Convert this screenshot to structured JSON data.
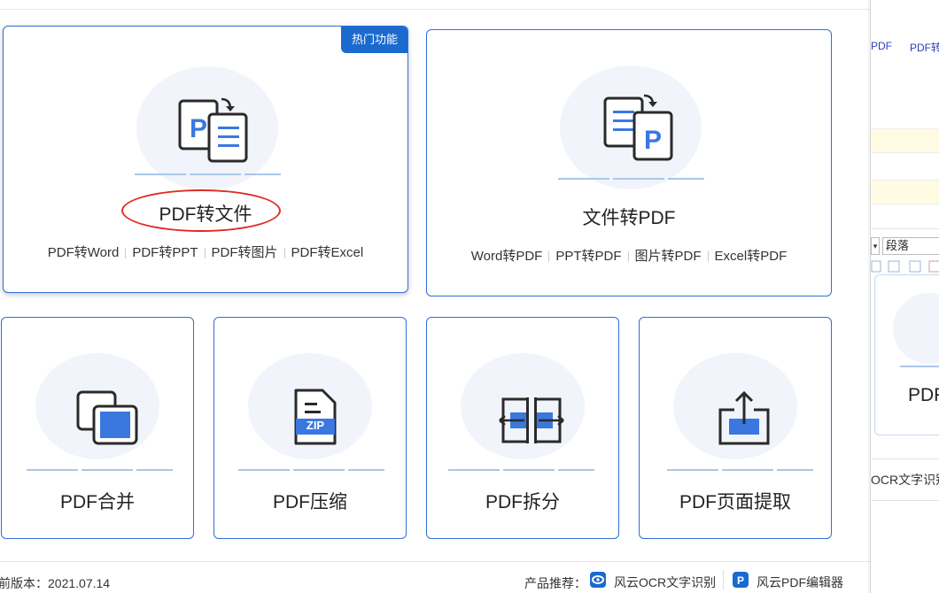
{
  "hot_badge": "热门功能",
  "cards": {
    "pdf_to_file": {
      "title": "PDF转文件",
      "links": [
        "PDF转Word",
        "PDF转PPT",
        "PDF转图片",
        "PDF转Excel"
      ]
    },
    "file_to_pdf": {
      "title": "文件转PDF",
      "links": [
        "Word转PDF",
        "PPT转PDF",
        "图片转PDF",
        "Excel转PDF"
      ]
    },
    "merge": {
      "title": "PDF合并",
      "icon": "merge-icon"
    },
    "compress": {
      "title": "PDF压缩",
      "icon": "zip-icon",
      "icon_text": "ZIP"
    },
    "split": {
      "title": "PDF拆分",
      "icon": "split-icon"
    },
    "extract": {
      "title": "PDF页面提取",
      "icon": "extract-icon"
    }
  },
  "footer": {
    "version": "前版本：2021.07.14",
    "recommend_label": "产品推荐：",
    "products": [
      "风云OCR文字识别",
      "风云PDF编辑器"
    ]
  },
  "right_pane": {
    "links": [
      "PDF",
      "PDF转"
    ],
    "style_select": "段落",
    "card_title": "PDF",
    "ocr_text": "OCR文字识别"
  },
  "colors": {
    "accent_blue": "#2f6fd6",
    "badge_blue": "#1a6ad0",
    "icon_blue": "#3a78e0",
    "highlight_red": "#e02a22"
  }
}
